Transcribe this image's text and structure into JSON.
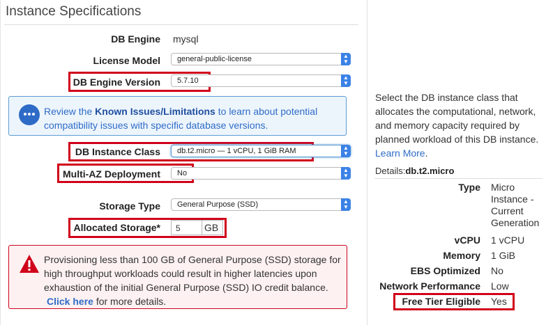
{
  "section_title": "Instance Specifications",
  "fields": {
    "db_engine": {
      "label": "DB Engine",
      "value": "mysql"
    },
    "license_model": {
      "label": "License Model",
      "value": "general-public-license"
    },
    "engine_version": {
      "label": "DB Engine Version",
      "value": "5.7.10"
    },
    "instance_class": {
      "label": "DB Instance Class",
      "value": "db.t2.micro — 1 vCPU, 1 GiB RAM"
    },
    "multi_az": {
      "label": "Multi-AZ Deployment",
      "value": "No"
    },
    "storage_type": {
      "label": "Storage Type",
      "value": "General Purpose (SSD)"
    },
    "allocated_storage": {
      "label": "Allocated Storage*",
      "value": "5",
      "unit": "GB"
    }
  },
  "info_box": {
    "prefix": "Review the ",
    "link": "Known Issues/Limitations",
    "suffix": " to learn about potential compatibility issues with specific database versions."
  },
  "warning_box": {
    "text": "Provisioning less than 100 GB of General Purpose (SSD) storage for high throughput workloads could result in higher latencies upon exhaustion of the initial General Purpose (SSD) IO credit balance.",
    "link": "Click here",
    "suffix": " for more details."
  },
  "side": {
    "description": "Select the DB instance class that allocates the computational, network, and memory capacity required by planned workload of this DB instance.",
    "learn_more": "Learn More",
    "period": ".",
    "details_prefix": "Details:",
    "details_instance": "db.t2.micro",
    "details": [
      {
        "label": "Type",
        "value": "Micro Instance - Current Generation"
      },
      {
        "label": "vCPU",
        "value": "1 vCPU"
      },
      {
        "label": "Memory",
        "value": "1 GiB"
      },
      {
        "label": "EBS Optimized",
        "value": "No"
      },
      {
        "label": "Network Performance",
        "value": "Low"
      },
      {
        "label": "Free Tier Eligible",
        "value": "Yes"
      }
    ]
  },
  "colors": {
    "accent": "#2e6bc7",
    "highlight": "#d0021b",
    "info_bg": "#edf5fc",
    "warn_bg": "#fdf1f1"
  },
  "icons": {
    "info": "speech-bubble-icon",
    "warning": "warning-triangle-icon",
    "select_arrows": "up-down-arrows-icon"
  }
}
